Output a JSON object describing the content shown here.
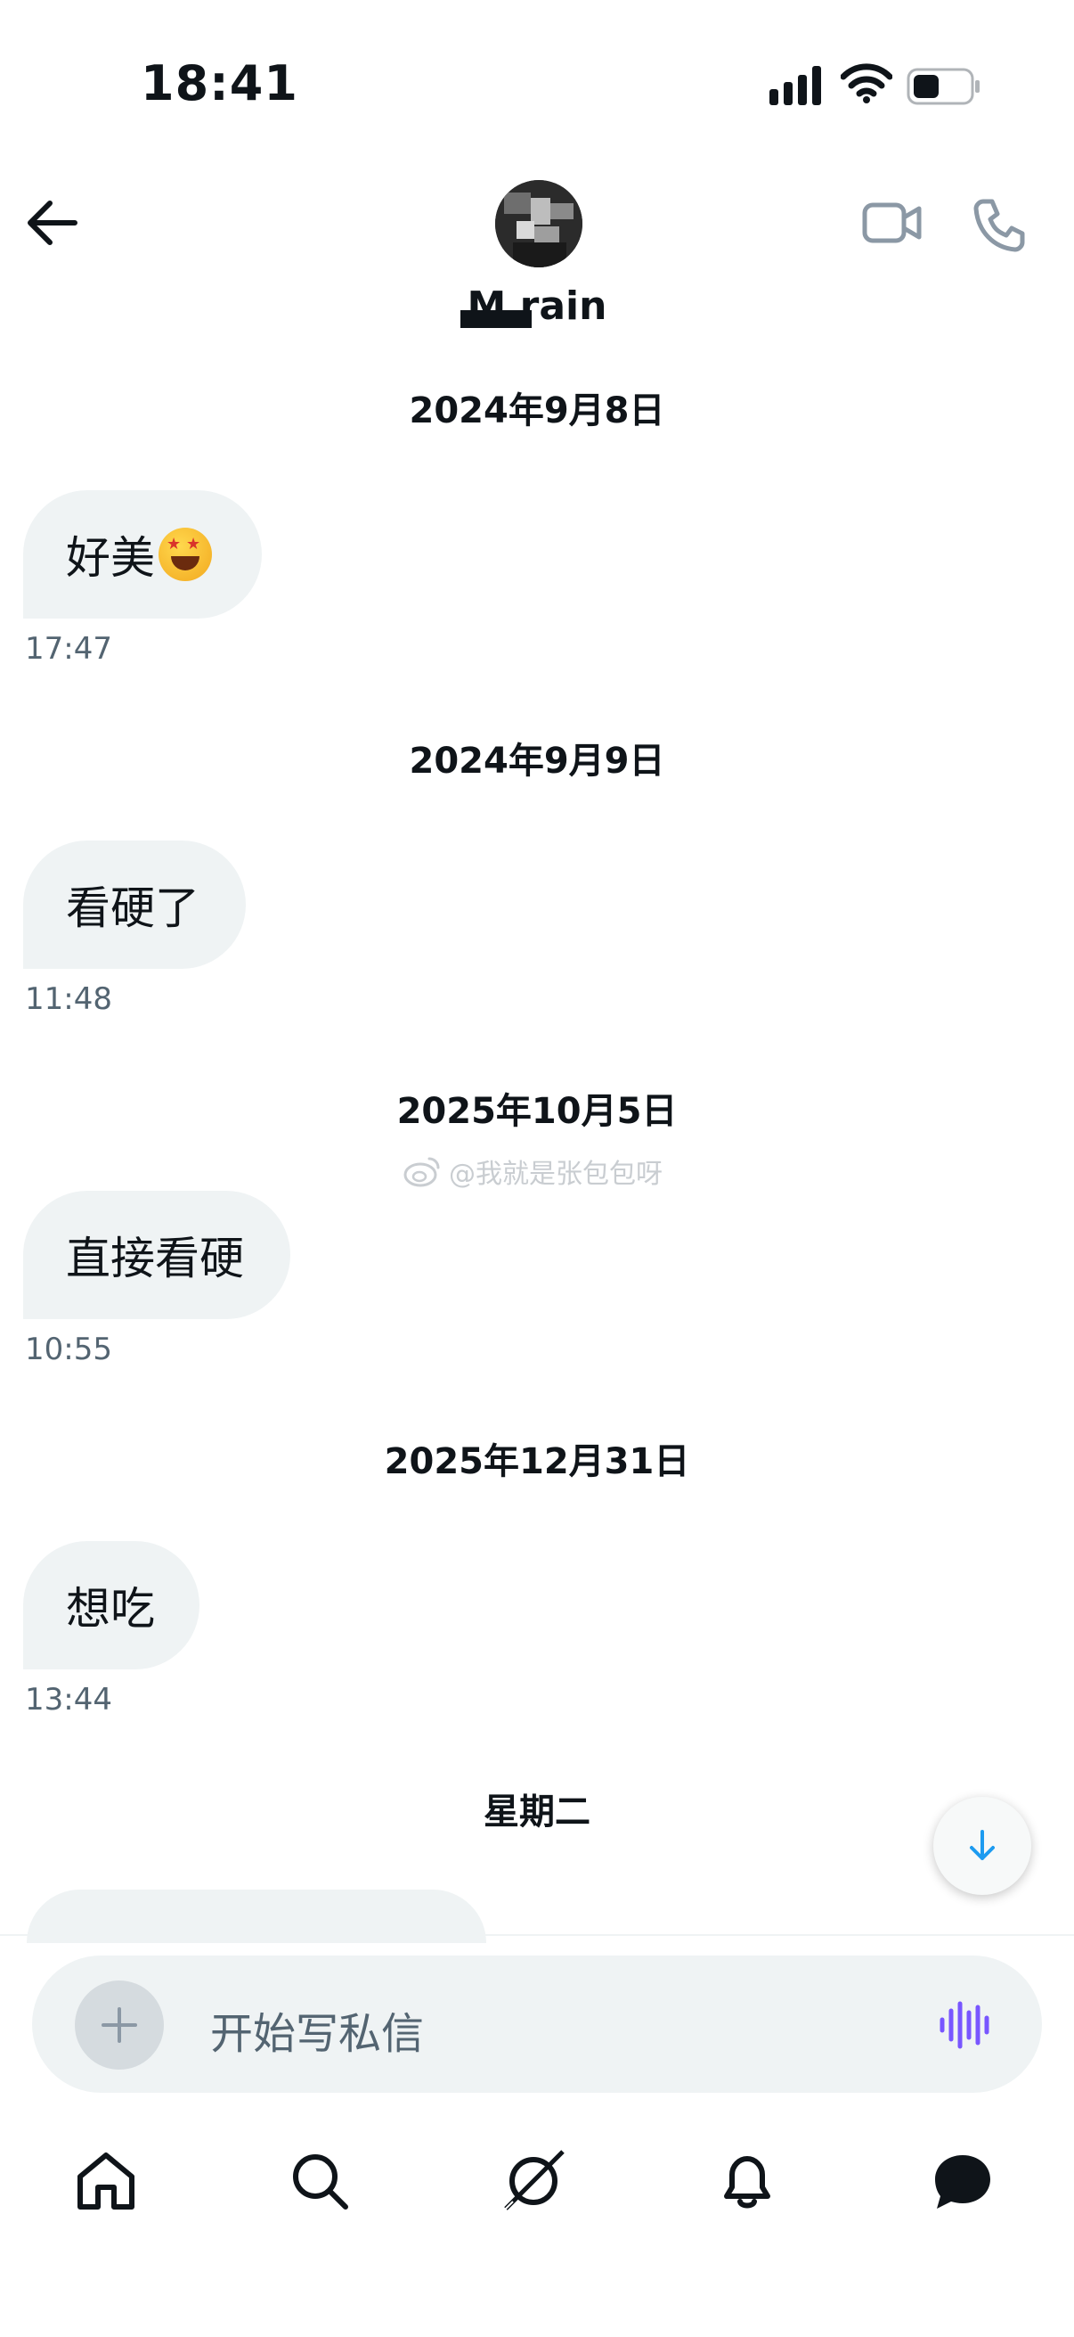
{
  "status_bar": {
    "time": "18:41"
  },
  "header": {
    "contact_name": "M  rain"
  },
  "messages": [
    {
      "date": "2024年9月8日",
      "text": "好美",
      "time": "17:47"
    },
    {
      "date": "2024年9月9日",
      "text": "看硬了",
      "time": "11:48"
    },
    {
      "date": "2025年10月5日",
      "text": "直接看硬",
      "time": "10:55"
    },
    {
      "date": "2025年12月31日",
      "text": "想吃",
      "time": "13:44"
    },
    {
      "date": "星期二"
    }
  ],
  "watermark": "@我就是张包包呀",
  "composer": {
    "placeholder": "开始写私信"
  },
  "tab_bar": [
    "home-icon",
    "search-icon",
    "grok-icon",
    "notifications-icon",
    "messages-icon"
  ],
  "colors": {
    "bubble": "#eff3f4",
    "accent_blue": "#1d9bf0",
    "voice_purple": "#7856ff",
    "text": "#0f1419",
    "muted": "#536471"
  }
}
